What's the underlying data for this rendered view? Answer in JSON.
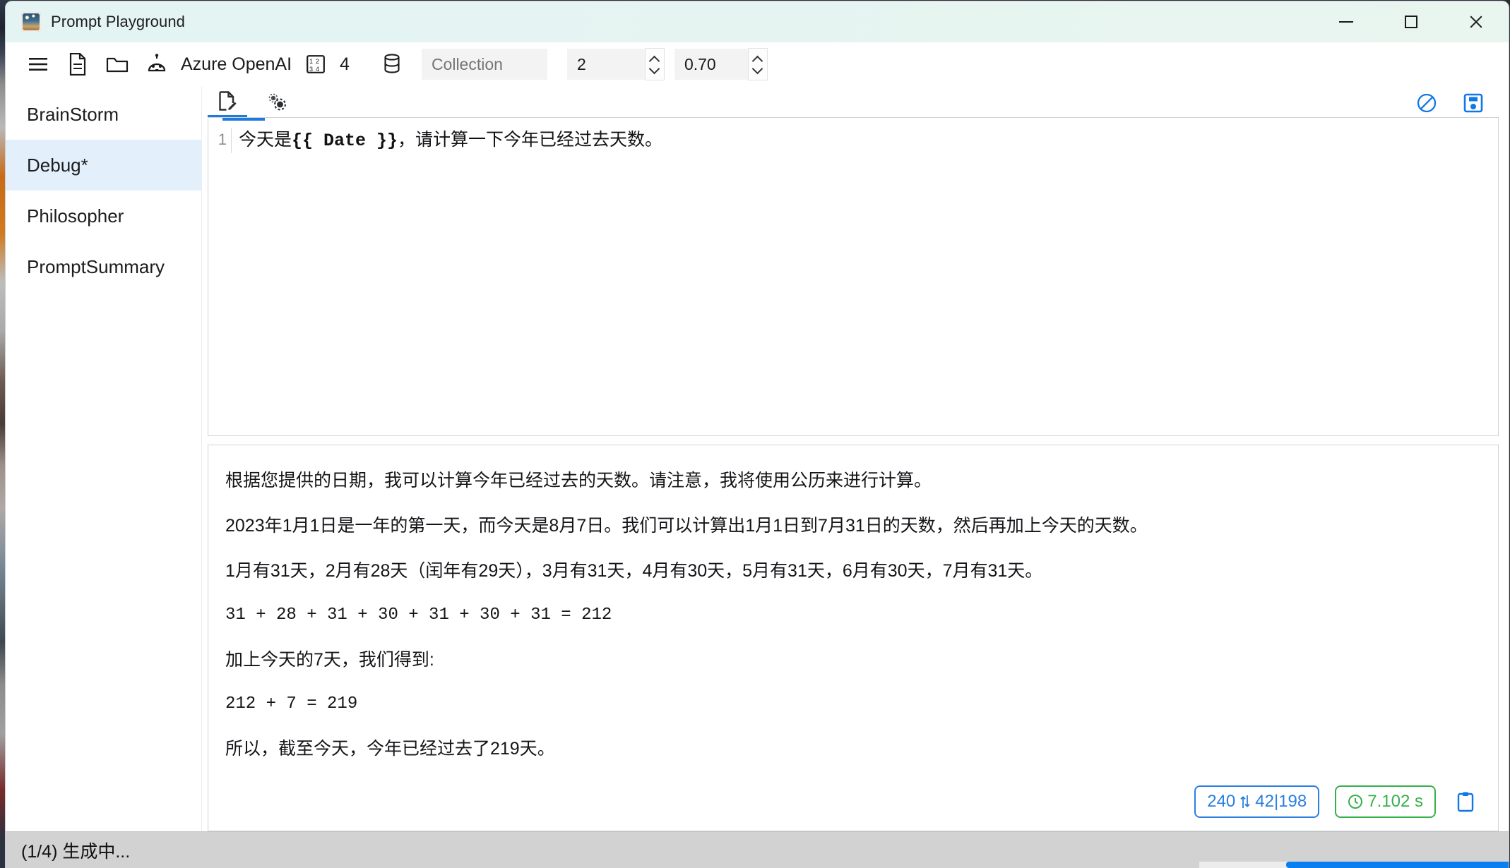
{
  "window": {
    "title": "Prompt Playground",
    "app_icon": "app-logo-icon",
    "controls": {
      "minimize": "minimize",
      "maximize": "maximize",
      "close": "close"
    }
  },
  "toolbar": {
    "menu_icon": "hamburger-menu-icon",
    "new_file_icon": "new-document-icon",
    "open_folder_icon": "open-folder-icon",
    "model_icon": "robot-icon",
    "model_label": "Azure OpenAI",
    "count_icon": "number-order-icon",
    "count_label": "4",
    "collection_icon": "database-icon",
    "collection_placeholder": "Collection",
    "collection_value": "",
    "n_value": "2",
    "temperature_value": "0.70",
    "spinner_up_icon": "chevron-up-icon",
    "spinner_down_icon": "chevron-down-icon"
  },
  "sidebar": {
    "items": [
      {
        "label": "BrainStorm",
        "active": false
      },
      {
        "label": "Debug*",
        "active": true
      },
      {
        "label": "Philosopher",
        "active": false
      },
      {
        "label": "PromptSummary",
        "active": false
      }
    ]
  },
  "tabstrip": {
    "tabs": [
      {
        "name": "prompt-tab",
        "icon": "document-edit-icon",
        "active": true
      },
      {
        "name": "settings-tab",
        "icon": "gears-icon",
        "active": false
      }
    ],
    "stop_icon": "stop-prohibited-icon",
    "save_icon": "save-floppy-icon"
  },
  "editor": {
    "line_number": "1",
    "text_before": "今天是",
    "variable": "{{ Date }}",
    "text_after": "，请计算一下今年已经过去天数。"
  },
  "response": {
    "paragraphs": [
      {
        "text": "根据您提供的日期，我可以计算今年已经过去的天数。请注意，我将使用公历来进行计算。",
        "code": false
      },
      {
        "text": "2023年1月1日是一年的第一天，而今天是8月7日。我们可以计算出1月1日到7月31日的天数，然后再加上今天的天数。",
        "code": false
      },
      {
        "text": "1月有31天，2月有28天（闰年有29天），3月有31天，4月有30天，5月有31天，6月有30天，7月有31天。",
        "code": false
      },
      {
        "text": "31 + 28 + 31 + 30 + 31 + 30 + 31 = 212",
        "code": true
      },
      {
        "text": "加上今天的7天，我们得到:",
        "code": false
      },
      {
        "text": "212 + 7 = 219",
        "code": true
      },
      {
        "text": "所以，截至今天，今年已经过去了219天。",
        "code": false
      }
    ],
    "badges": {
      "tokens_total": "240",
      "tokens_arrows_icon": "up-down-arrows-icon",
      "tokens_breakdown": "42|198",
      "timing_icon": "clock-icon",
      "timing_text": "7.102 s",
      "copy_icon": "clipboard-copy-icon"
    }
  },
  "statusbar": {
    "text": "(1/4) 生成中...",
    "progress_percent": 72
  },
  "colors": {
    "accent_blue": "#1f7ae0",
    "badge_blue": "#2a7fe0",
    "badge_green": "#35b14a",
    "sidebar_active": "#e3effb",
    "titlebar": "#e3f4f3",
    "statusbar": "#d2d2d2"
  }
}
